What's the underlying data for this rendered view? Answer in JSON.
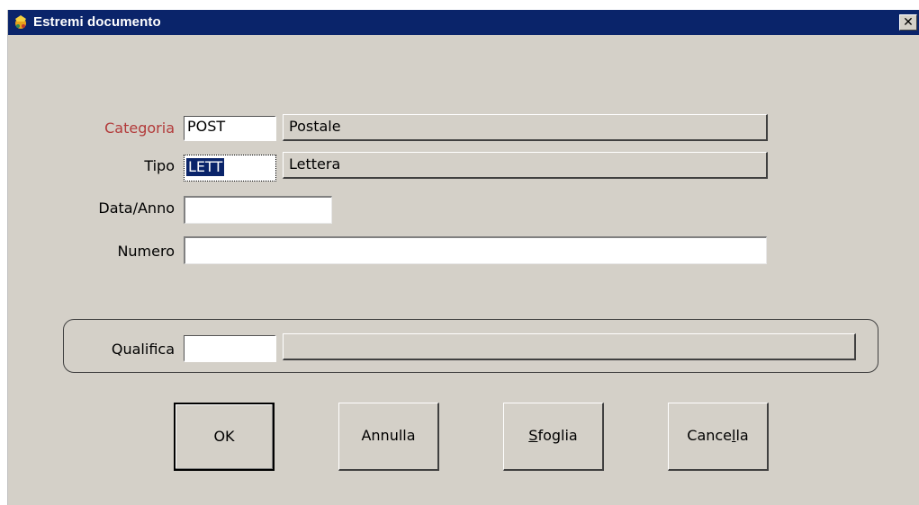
{
  "window": {
    "title": "Estremi documento",
    "close_glyph": "✕"
  },
  "form": {
    "categoria": {
      "label": "Categoria",
      "code": "POST",
      "description": "Postale"
    },
    "tipo": {
      "label": "Tipo",
      "code": "LETT",
      "description": "Lettera"
    },
    "data_anno": {
      "label": "Data/Anno",
      "value": ""
    },
    "numero": {
      "label": "Numero",
      "value": ""
    },
    "qualifica": {
      "label": "Qualifica",
      "code": "",
      "description": ""
    }
  },
  "buttons": {
    "ok": "OK",
    "annulla": "Annulla",
    "sfoglia_prefix": "S",
    "sfoglia_rest": "foglia",
    "cancella_pre": "Cance",
    "cancella_u": "l",
    "cancella_post": "la"
  },
  "colors": {
    "titlebar": "#0a246a",
    "face": "#d4d0c8",
    "required_label": "#b23a3a",
    "selection": "#0a246a"
  }
}
